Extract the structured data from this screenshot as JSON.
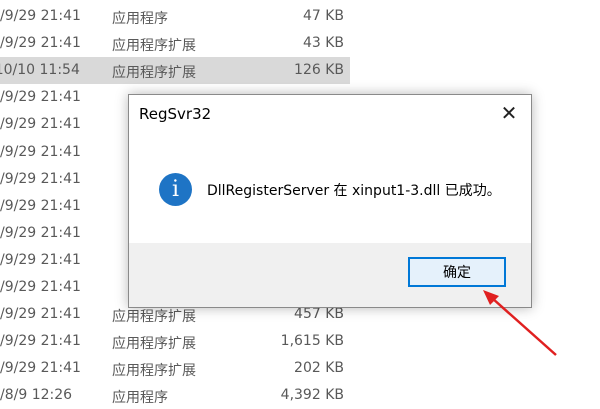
{
  "files": [
    {
      "date": "/9/29 21:41",
      "type": "应用程序",
      "size": "47 KB"
    },
    {
      "date": "/9/29 21:41",
      "type": "应用程序扩展",
      "size": "43 KB"
    },
    {
      "date": "/10/10 11:54",
      "type": "应用程序扩展",
      "size": "126 KB",
      "selected": true
    },
    {
      "date": "/9/29 21:41",
      "type": "",
      "size": ""
    },
    {
      "date": "/9/29 21:41",
      "type": "",
      "size": ""
    },
    {
      "date": "/9/29 21:41",
      "type": "",
      "size": ""
    },
    {
      "date": "/9/29 21:41",
      "type": "",
      "size": ""
    },
    {
      "date": "/9/29 21:41",
      "type": "",
      "size": ""
    },
    {
      "date": "/9/29 21:41",
      "type": "",
      "size": ""
    },
    {
      "date": "/9/29 21:41",
      "type": "",
      "size": ""
    },
    {
      "date": "/9/29 21:41",
      "type": "",
      "size": ""
    },
    {
      "date": "/9/29 21:41",
      "type": "应用程序扩展",
      "size": "457 KB"
    },
    {
      "date": "/9/29 21:41",
      "type": "应用程序扩展",
      "size": "1,615 KB"
    },
    {
      "date": "/9/29 21:41",
      "type": "应用程序扩展",
      "size": "202 KB"
    },
    {
      "date": "/8/9 12:26",
      "type": "应用程序",
      "size": "4,392 KB"
    }
  ],
  "dialog": {
    "title": "RegSvr32",
    "close_glyph": "✕",
    "icon_glyph": "i",
    "message": "DllRegisterServer 在 xinput1-3.dll 已成功。",
    "ok_label": "确定"
  },
  "colors": {
    "accent": "#0078d7",
    "info_icon": "#1e74c5",
    "arrow": "#e02020"
  }
}
